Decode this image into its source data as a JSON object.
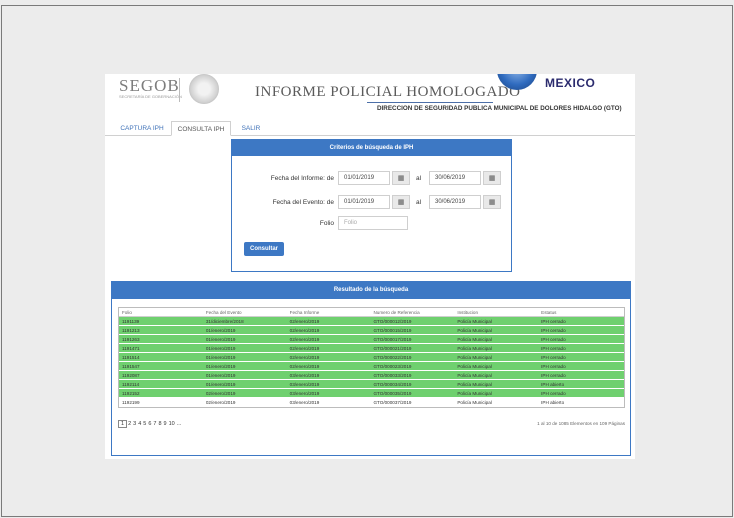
{
  "header": {
    "segob": "SEGOB",
    "segob_sub": "SECRETARÍA DE GOBERNACIÓN",
    "title": "INFORME POLICIAL HOMOLOGADO",
    "country": "MEXICO",
    "direccion": "DIRECCION DE SEGURIDAD PUBLICA MUNICIPAL DE DOLORES HIDALGO (GTO)"
  },
  "tabs": [
    "CAPTURA IPH",
    "CONSULTA IPH",
    "SALIR"
  ],
  "criteria": {
    "title": "Criterios de búsqueda de IPH",
    "fecha_informe_label": "Fecha del Informe: de",
    "fecha_informe_from": "01/01/2019",
    "fecha_informe_to": "30/06/2019",
    "fecha_evento_label": "Fecha del Evento: de",
    "fecha_evento_from": "01/01/2019",
    "fecha_evento_to": "30/06/2019",
    "al": "al",
    "folio_label": "Folio",
    "folio_placeholder": "Folio",
    "consultar": "Consultar"
  },
  "results": {
    "title": "Resultado de la búsqueda",
    "columns": [
      "Folio",
      "Fecha del Evento",
      "Fecha Informe",
      "Numero de Referencia",
      "Institucion",
      "Estatus"
    ],
    "rows": [
      [
        "1191139",
        "31/diciembre/2018",
        "02/enero/2019",
        "GTO/000012/2019",
        "Policía Municipal",
        "IPH cerrado"
      ],
      [
        "1191213",
        "01/enero/2019",
        "02/enero/2019",
        "GTO/000015/2019",
        "Policía Municipal",
        "IPH cerrado"
      ],
      [
        "1191263",
        "01/enero/2019",
        "02/enero/2019",
        "GTO/000017/2019",
        "Policía Municipal",
        "IPH cerrado"
      ],
      [
        "1191471",
        "01/enero/2019",
        "02/enero/2019",
        "GTO/000021/2019",
        "Policía Municipal",
        "IPH cerrado"
      ],
      [
        "1191514",
        "01/enero/2019",
        "02/enero/2019",
        "GTO/000022/2019",
        "Policía Municipal",
        "IPH cerrado"
      ],
      [
        "1191547",
        "01/enero/2019",
        "02/enero/2019",
        "GTO/000023/2019",
        "Policía Municipal",
        "IPH cerrado"
      ],
      [
        "1192087",
        "01/enero/2019",
        "03/enero/2019",
        "GTO/000033/2019",
        "Policía Municipal",
        "IPH cerrado"
      ],
      [
        "1192114",
        "01/enero/2019",
        "03/enero/2019",
        "GTO/000034/2019",
        "Policía Municipal",
        "IPH abierto"
      ],
      [
        "1192152",
        "02/enero/2019",
        "03/enero/2019",
        "GTO/000035/2019",
        "Policía Municipal",
        "IPH cerrado"
      ],
      [
        "1192199",
        "02/enero/2019",
        "03/enero/2019",
        "GTO/000037/2019",
        "Policía Municipal",
        "IPH abierto"
      ]
    ],
    "row_colors": [
      "g",
      "g",
      "g",
      "g",
      "g",
      "g",
      "g",
      "g",
      "g",
      "w"
    ],
    "pages": [
      "1",
      "2",
      "3",
      "4",
      "5",
      "6",
      "7",
      "8",
      "9",
      "10",
      "..."
    ],
    "info": "1 al 10 de 1085 Elementos en 109 Páginas"
  }
}
